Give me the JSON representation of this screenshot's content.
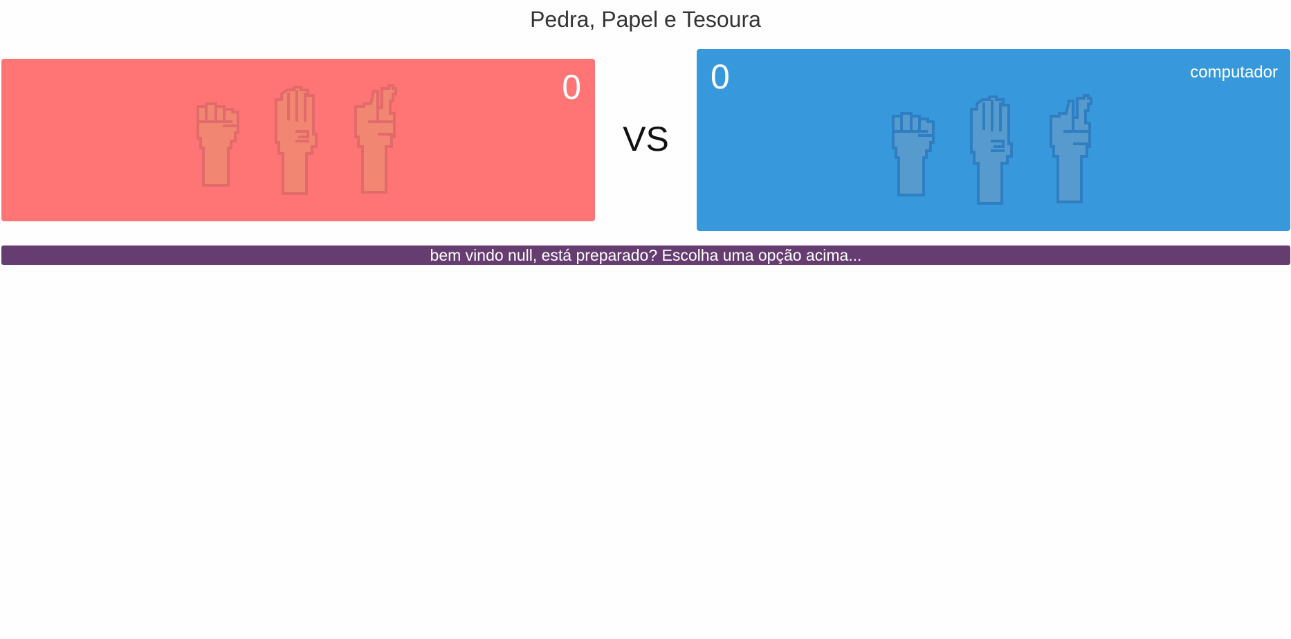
{
  "title": "Pedra, Papel e Tesoura",
  "colors": {
    "player_panel": "#ff7474",
    "player_hand_fill": "#f08872",
    "player_hand_stroke": "#e06a6a",
    "computer_panel": "#3798db",
    "computer_hand_fill": "#5b9bcc",
    "computer_hand_stroke": "#2f7cc0",
    "message_bar": "#663d70"
  },
  "player": {
    "score": "0",
    "choices": [
      {
        "name": "pedra",
        "icon": "rock-fist-icon"
      },
      {
        "name": "papel",
        "icon": "paper-hand-icon"
      },
      {
        "name": "tesoura",
        "icon": "scissors-hand-icon"
      }
    ]
  },
  "versus_label": "VS",
  "computer": {
    "label": "computador",
    "score": "0",
    "choices": [
      {
        "name": "pedra",
        "icon": "rock-fist-icon"
      },
      {
        "name": "papel",
        "icon": "paper-hand-icon"
      },
      {
        "name": "tesoura",
        "icon": "scissors-hand-icon"
      }
    ]
  },
  "message": "bem vindo null, está preparado? Escolha uma opção acima..."
}
